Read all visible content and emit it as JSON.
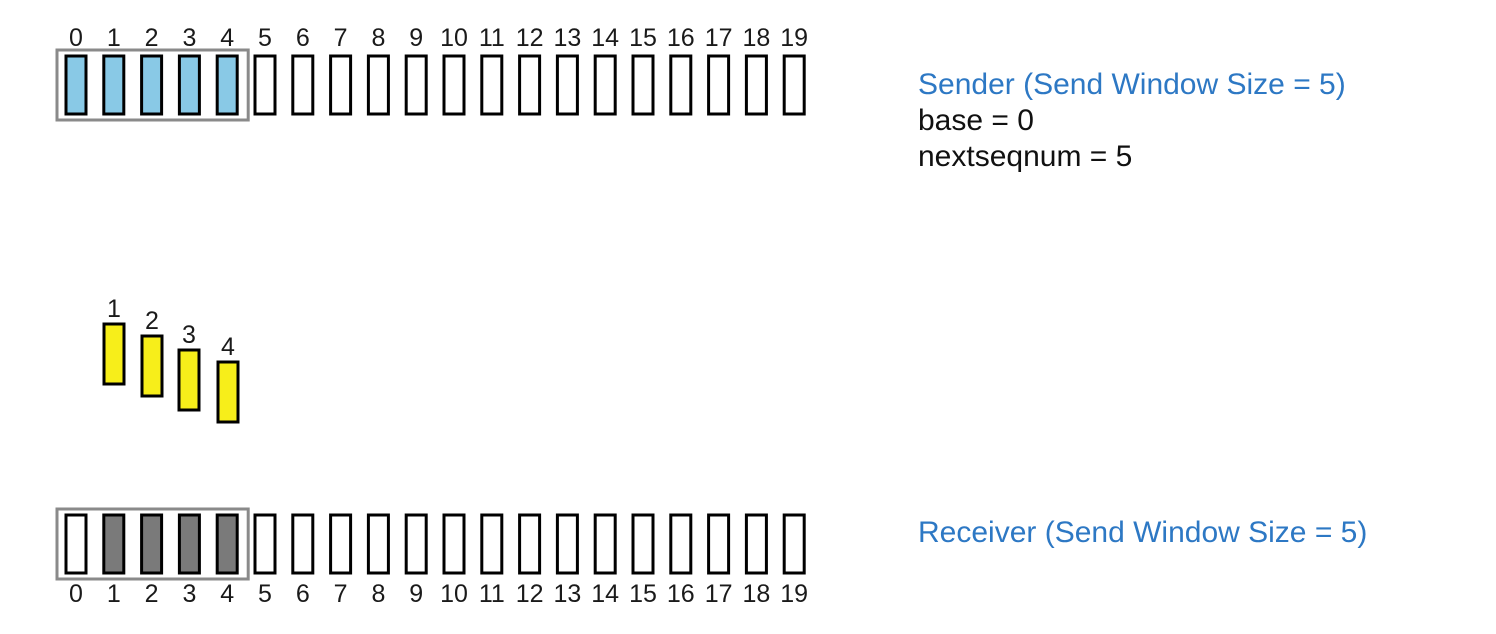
{
  "sender": {
    "title": "Sender (Send Window Size = 5)",
    "base_text": "base = 0",
    "nextseqnum_text": "nextseqnum = 5",
    "window": {
      "start": 0,
      "end": 4
    },
    "sequence": [
      {
        "label": "0",
        "state": "sent"
      },
      {
        "label": "1",
        "state": "sent"
      },
      {
        "label": "2",
        "state": "sent"
      },
      {
        "label": "3",
        "state": "sent"
      },
      {
        "label": "4",
        "state": "sent"
      },
      {
        "label": "5",
        "state": "empty"
      },
      {
        "label": "6",
        "state": "empty"
      },
      {
        "label": "7",
        "state": "empty"
      },
      {
        "label": "8",
        "state": "empty"
      },
      {
        "label": "9",
        "state": "empty"
      },
      {
        "label": "10",
        "state": "empty"
      },
      {
        "label": "11",
        "state": "empty"
      },
      {
        "label": "12",
        "state": "empty"
      },
      {
        "label": "13",
        "state": "empty"
      },
      {
        "label": "14",
        "state": "empty"
      },
      {
        "label": "15",
        "state": "empty"
      },
      {
        "label": "16",
        "state": "empty"
      },
      {
        "label": "17",
        "state": "empty"
      },
      {
        "label": "18",
        "state": "empty"
      },
      {
        "label": "19",
        "state": "empty"
      }
    ]
  },
  "in_flight": [
    {
      "label": "1"
    },
    {
      "label": "2"
    },
    {
      "label": "3"
    },
    {
      "label": "4"
    }
  ],
  "receiver": {
    "title": "Receiver (Send Window Size = 5)",
    "window": {
      "start": 0,
      "end": 4
    },
    "sequence": [
      {
        "label": "0",
        "state": "empty"
      },
      {
        "label": "1",
        "state": "received"
      },
      {
        "label": "2",
        "state": "received"
      },
      {
        "label": "3",
        "state": "received"
      },
      {
        "label": "4",
        "state": "received"
      },
      {
        "label": "5",
        "state": "empty"
      },
      {
        "label": "6",
        "state": "empty"
      },
      {
        "label": "7",
        "state": "empty"
      },
      {
        "label": "8",
        "state": "empty"
      },
      {
        "label": "9",
        "state": "empty"
      },
      {
        "label": "10",
        "state": "empty"
      },
      {
        "label": "11",
        "state": "empty"
      },
      {
        "label": "12",
        "state": "empty"
      },
      {
        "label": "13",
        "state": "empty"
      },
      {
        "label": "14",
        "state": "empty"
      },
      {
        "label": "15",
        "state": "empty"
      },
      {
        "label": "16",
        "state": "empty"
      },
      {
        "label": "17",
        "state": "empty"
      },
      {
        "label": "18",
        "state": "empty"
      },
      {
        "label": "19",
        "state": "empty"
      }
    ]
  },
  "colors": {
    "sent": "#89c9e6",
    "received": "#7a7a7a",
    "in_flight": "#f7ee1a",
    "empty": "#ffffff",
    "title": "#2d78c4",
    "window_border": "#8a8a8a"
  }
}
